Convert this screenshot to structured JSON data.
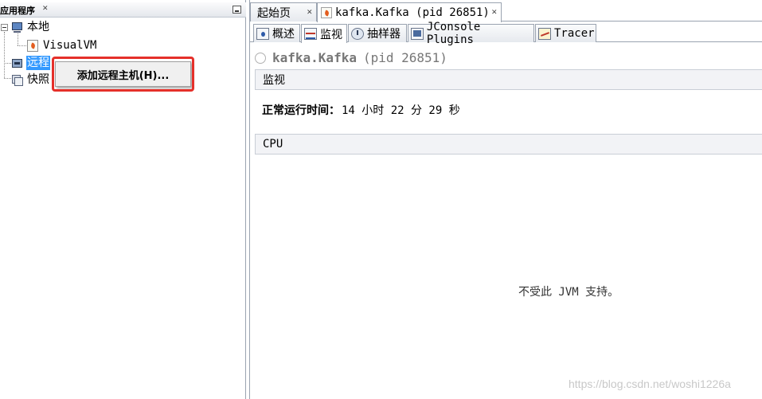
{
  "left_panel": {
    "title": "应用程序",
    "close_glyph": "✕",
    "tree": {
      "local": {
        "label": "本地"
      },
      "visualvm": {
        "label": "VisualVM"
      },
      "remote": {
        "label": "远程"
      },
      "snapshots": {
        "label": "快照"
      }
    }
  },
  "context_menu": {
    "items": [
      {
        "label": "添加远程主机(H)..."
      }
    ]
  },
  "doc_tabs": [
    {
      "label": "起始页",
      "close": "✕"
    },
    {
      "label": "kafka.Kafka (pid 26851)",
      "close": "✕"
    }
  ],
  "sub_tabs": [
    {
      "label": "概述"
    },
    {
      "label": "监视"
    },
    {
      "label": "抽样器"
    },
    {
      "label": "JConsole Plugins"
    },
    {
      "label": "Tracer"
    }
  ],
  "main": {
    "app_name": "kafka.Kafka",
    "app_pid": "(pid 26851)",
    "monitor_section": "监视",
    "uptime_label": "正常运行时间：",
    "uptime_value": "14 小时 22 分 29 秒",
    "cpu_section": "CPU",
    "cpu_message": "不受此 JVM 支持。"
  },
  "watermark": "https://blog.csdn.net/woshi1226a",
  "colors": {
    "selection": "#3399ff",
    "highlight_border": "#e5302a"
  }
}
